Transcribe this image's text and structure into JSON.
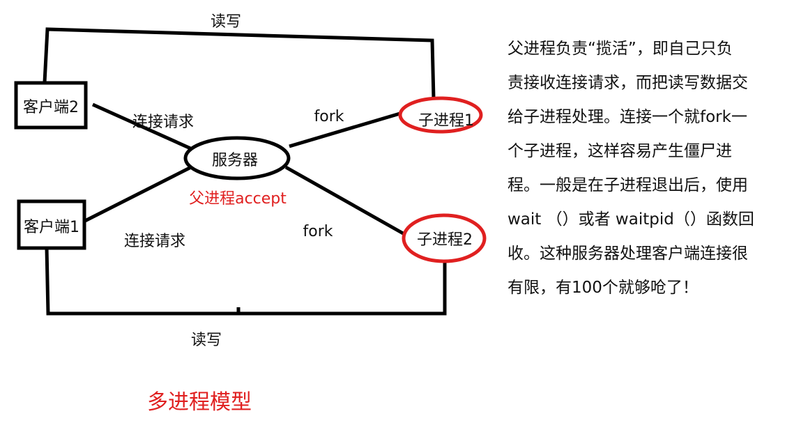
{
  "diagram": {
    "nodes": {
      "server": "服务器",
      "client1": "客户端1",
      "client2": "客户端2",
      "child1": "子进程1",
      "child2": "子进程2"
    },
    "edge_labels": {
      "read_write_top": "读写",
      "read_write_bottom": "读写",
      "connect_request_top": "连接请求",
      "connect_request_bottom": "连接请求",
      "fork_top": "fork",
      "fork_bottom": "fork"
    },
    "server_note": "父进程accept",
    "caption": "多进程模型",
    "colors": {
      "line": "#000000",
      "highlight": "#e02020"
    }
  },
  "explanation": {
    "lines": [
      "父进程负责“揽活”，即自己只负",
      "责接收连接请求，而把读写数据交",
      "给子进程处理。连接一个就fork一",
      "个子进程，这样容易产生僵尸进",
      "程。一般是在子进程退出后，使用",
      "wait （）或者 waitpid（）函数回",
      "收。这种服务器处理客户端连接很",
      "有限，有100个就够呛了！"
    ]
  }
}
